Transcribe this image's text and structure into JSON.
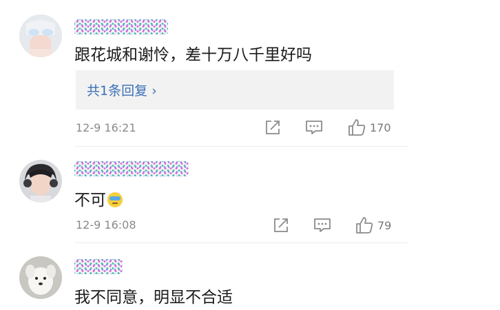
{
  "comments": [
    {
      "text": "跟花城和谢怜，差十万八千里好吗",
      "replies_label": "共1条回复 ›",
      "time": "12-9 16:21",
      "likes": "170",
      "avatar": "avatar-girl-hands",
      "username_blurred": true
    },
    {
      "text": "不可",
      "emoji": "face-with-bandage-eyes",
      "time": "12-9 16:08",
      "likes": "79",
      "avatar": "avatar-boy-headphones",
      "username_blurred": true
    },
    {
      "text": "我不同意，明显不合适",
      "avatar": "avatar-white-dog",
      "username_blurred": true
    }
  ],
  "icons": {
    "share": "share-icon",
    "comment": "comment-icon",
    "like": "thumbs-up-icon"
  },
  "colors": {
    "reply_link": "#3a6fb5",
    "meta_text": "#8a8a8a",
    "reply_bg": "#f2f2f2"
  }
}
